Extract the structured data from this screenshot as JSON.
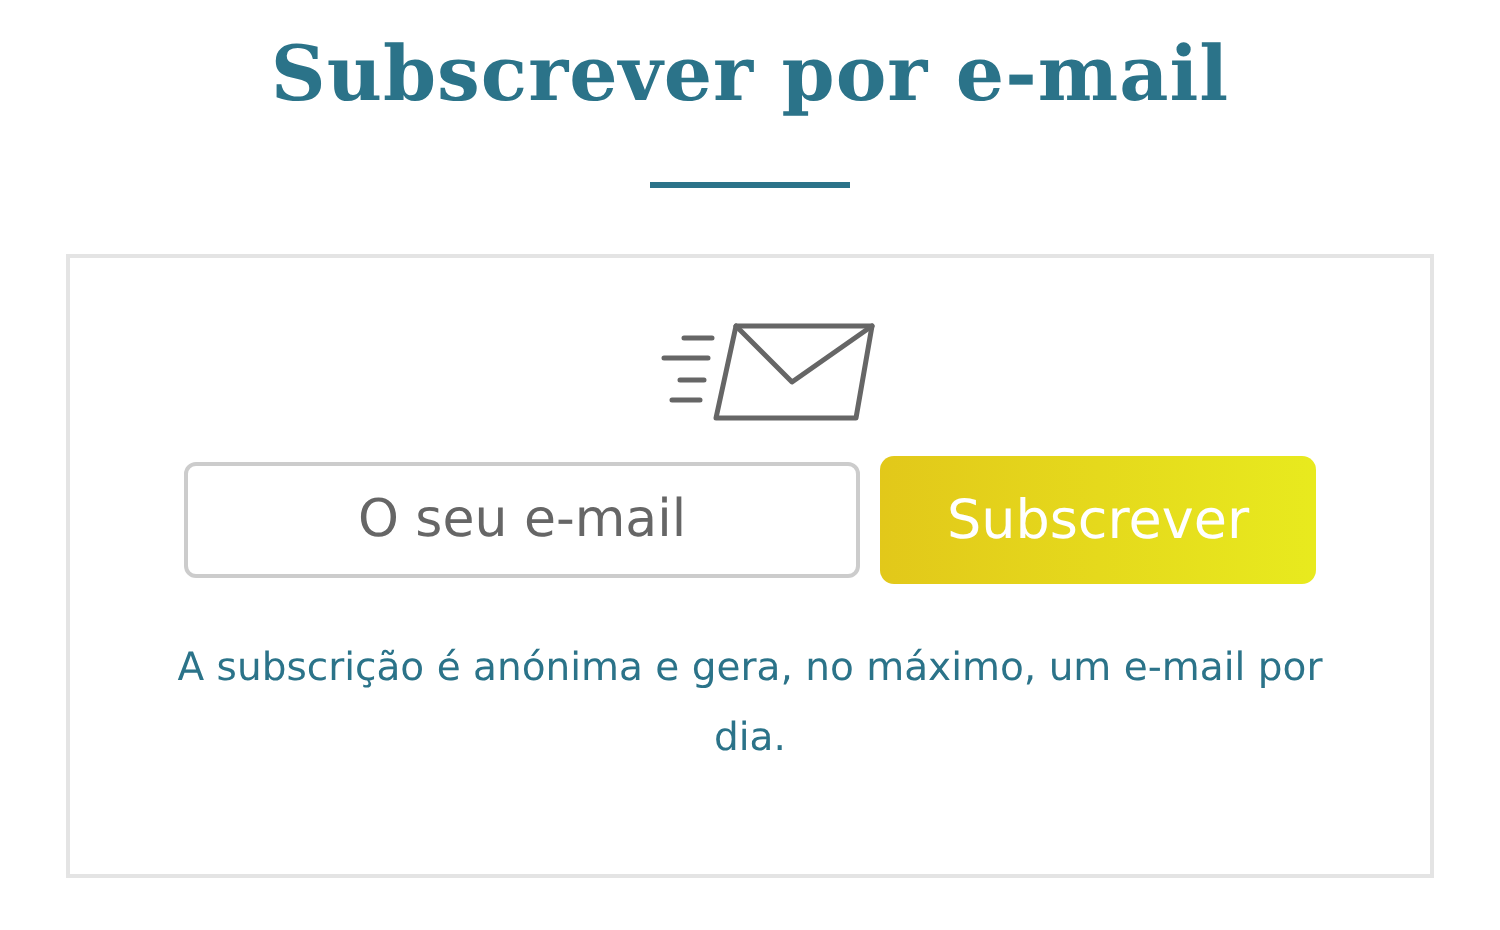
{
  "title": "Subscrever por e-mail",
  "form": {
    "placeholder": "O seu e-mail",
    "button": "Subscrever"
  },
  "note": "A subscrição é anónima e gera, no máximo, um e-mail por dia."
}
